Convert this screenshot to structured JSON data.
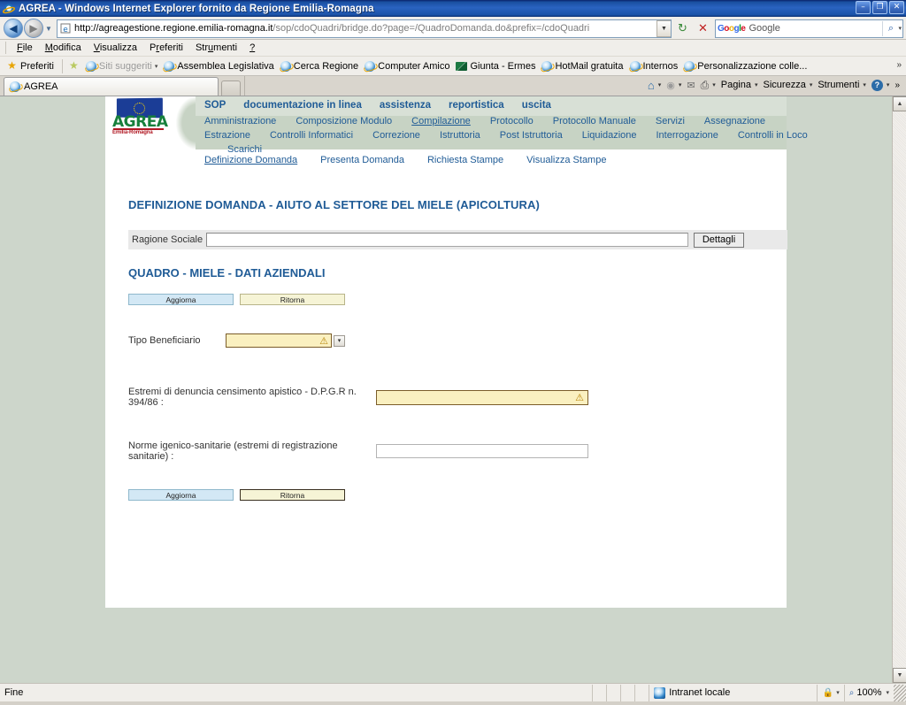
{
  "window": {
    "title": "AGREA - Windows Internet Explorer fornito da Regione Emilia-Romagna",
    "app_icon": "ie-icon",
    "minimize": "minimize-icon",
    "maximize": "restore-icon",
    "close": "close-icon",
    "minimize_glyph": "–",
    "maximize_glyph": "❐",
    "close_glyph": "✕"
  },
  "nav": {
    "back_glyph": "◀",
    "forward_glyph": "▶",
    "history_glyph": "▼",
    "url_protocol": "http://agreagestione.regione.emilia-romagna.it",
    "url_path": "/sop/cdoQuadri/bridge.do?page=/QuadroDomanda.do&prefix=/cdoQuadri",
    "url_dropdown_glyph": "▼",
    "refresh_glyph": "↻",
    "stop_glyph": "✕",
    "search_placeholder": "Google",
    "search_value": "",
    "search_glyph": "⌕",
    "search_caret_glyph": "▾"
  },
  "menubar": [
    {
      "pre": "",
      "key": "F",
      "post": "ile"
    },
    {
      "pre": "",
      "key": "M",
      "post": "odifica"
    },
    {
      "pre": "",
      "key": "V",
      "post": "isualizza"
    },
    {
      "pre": "P",
      "key": "r",
      "post": "eferiti"
    },
    {
      "pre": "Str",
      "key": "u",
      "post": "menti"
    },
    {
      "pre": "",
      "key": "?",
      "post": ""
    }
  ],
  "favorites": {
    "button_label": "Preferiti",
    "suggested_label": "Siti suggeriti",
    "suggested_caret": "▾",
    "items": [
      {
        "label": "Assemblea Legislativa",
        "icon": "ie-icon"
      },
      {
        "label": "Cerca Regione",
        "icon": "ie-icon"
      },
      {
        "label": "Computer Amico",
        "icon": "ie-icon"
      },
      {
        "label": "Giunta - Ermes",
        "icon": "green-flag-icon"
      },
      {
        "label": "HotMail gratuita",
        "icon": "ie-icon"
      },
      {
        "label": "Internos",
        "icon": "ie-icon"
      },
      {
        "label": "Personalizzazione colle...",
        "icon": "ie-icon"
      }
    ],
    "overflow_glyph": "»"
  },
  "tabs": {
    "active": "AGREA",
    "new_tab_label": ""
  },
  "commandbar": {
    "home_glyph": "⌂",
    "feeds_glyph": "◉",
    "mail_glyph": "✉",
    "print_glyph": "⎙",
    "caret": "▾",
    "items": [
      "Pagina",
      "Sicurezza",
      "Strumenti"
    ],
    "help_glyph": "?",
    "overflow_glyph": "»"
  },
  "page": {
    "logo": {
      "wordmark": "AGREA",
      "subtitle": "Emilia-Romagna"
    },
    "nav_primary": [
      "SOP",
      "documentazione in linea",
      "assistenza",
      "reportistica",
      "uscita"
    ],
    "nav_secondary_row1": [
      {
        "label": "Amministrazione",
        "active": false
      },
      {
        "label": "Composizione Modulo",
        "active": false
      },
      {
        "label": "Compilazione",
        "active": true
      },
      {
        "label": "Protocollo",
        "active": false
      },
      {
        "label": "Protocollo Manuale",
        "active": false
      },
      {
        "label": "Servizi",
        "active": false
      },
      {
        "label": "Assegnazione",
        "active": false
      }
    ],
    "nav_secondary_row2": [
      {
        "label": "Estrazione",
        "active": false
      },
      {
        "label": "Controlli Informatici",
        "active": false
      },
      {
        "label": "Correzione",
        "active": false
      },
      {
        "label": "Istruttoria",
        "active": false
      },
      {
        "label": "Post Istruttoria",
        "active": false
      },
      {
        "label": "Liquidazione",
        "active": false
      },
      {
        "label": "Interrogazione",
        "active": false
      },
      {
        "label": "Controlli in Loco",
        "active": false
      }
    ],
    "nav_secondary_row3": [
      {
        "label": "Scarichi",
        "active": false
      }
    ],
    "nav_tertiary": [
      {
        "label": "Definizione Domanda",
        "active": true
      },
      {
        "label": "Presenta Domanda",
        "active": false
      },
      {
        "label": "Richiesta Stampe",
        "active": false
      },
      {
        "label": "Visualizza Stampe",
        "active": false
      }
    ],
    "title": "DEFINIZIONE DOMANDA - AIUTO AL SETTORE DEL MIELE (APICOLTURA)",
    "ragione_sociale_label": "Ragione Sociale",
    "ragione_sociale_value": "",
    "dettagli_button": "Dettagli",
    "subtitle": "QUADRO - MIELE - DATI AZIENDALI",
    "buttons_top": {
      "update": "Aggiorna",
      "return": "Ritorna"
    },
    "buttons_bottom": {
      "update": "Aggiorna",
      "return": "Ritorna"
    },
    "fields": {
      "tipo_beneficiario_label": "Tipo Beneficiario",
      "tipo_beneficiario_value": "",
      "tipo_beneficiario_caret": "▾",
      "estremi_label": "Estremi di denuncia censimento apistico - D.P.G.R n. 394/86 :",
      "estremi_value": "",
      "norme_label": "Norme igenico-sanitarie (estremi di registrazione sanitarie) :",
      "norme_value": "",
      "warning_glyph": "⚠"
    }
  },
  "statusbar": {
    "text": "Fine",
    "zone": "Intranet locale",
    "zone_icon": "shield-icon",
    "protected_icon": "lock-icon",
    "protected_caret": "▾",
    "zoom_level": "100%",
    "zoom_icon": "magnifier-icon",
    "zoom_caret": "▾"
  },
  "scrollbar": {
    "up_glyph": "▲",
    "down_glyph": "▼"
  },
  "colors": {
    "accent_blue": "#1f5b96",
    "header_green": "#c7d3c4",
    "page_green": "#cdd6cb",
    "yellow_field": "#faf0c0",
    "blue_button": "#d3e8f5"
  }
}
